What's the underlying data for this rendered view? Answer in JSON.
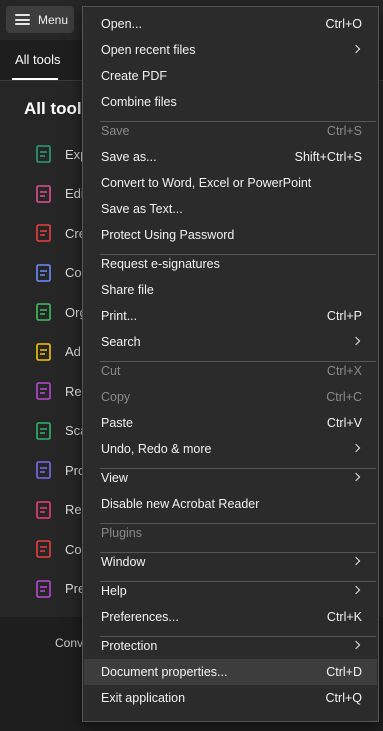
{
  "app": {
    "menu_button_label": "Menu",
    "tab_all_tools": "All tools",
    "panel_title": "All tools",
    "tools": [
      {
        "label": "Exp",
        "icon": "export-pdf-icon",
        "color": "#2d9d78"
      },
      {
        "label": "Edi",
        "icon": "edit-pdf-icon",
        "color": "#e34f8f"
      },
      {
        "label": "Cre",
        "icon": "create-pdf-icon",
        "color": "#eb3f3f"
      },
      {
        "label": "Co",
        "icon": "combine-files-icon",
        "color": "#6b8cff"
      },
      {
        "label": "Org",
        "icon": "organize-pages-icon",
        "color": "#3fbf5f"
      },
      {
        "label": "Ad",
        "icon": "add-comment-icon",
        "color": "#f5c400"
      },
      {
        "label": "Re",
        "icon": "request-signatures-icon",
        "color": "#b84ad6"
      },
      {
        "label": "Sca",
        "icon": "scan-ocr-icon",
        "color": "#2fb36b"
      },
      {
        "label": "Pro",
        "icon": "protect-icon",
        "color": "#7a6cf0"
      },
      {
        "label": "Re",
        "icon": "redact-icon",
        "color": "#eb3f7a"
      },
      {
        "label": "Co",
        "icon": "compress-pdf-icon",
        "color": "#eb3f3f"
      },
      {
        "label": "Pre",
        "icon": "prepare-form-icon",
        "color": "#b84ad6"
      }
    ],
    "below_panel_text": "Conve"
  },
  "menu": {
    "items": [
      {
        "label": "Open...",
        "shortcut": "Ctrl+O"
      },
      {
        "label": "Open recent files",
        "submenu": true
      },
      {
        "label": "Create PDF"
      },
      {
        "label": "Combine files"
      },
      {
        "label": "Save",
        "shortcut": "Ctrl+S",
        "disabled": true
      },
      {
        "label": "Save as...",
        "shortcut": "Shift+Ctrl+S"
      },
      {
        "label": "Convert to Word, Excel or PowerPoint"
      },
      {
        "label": "Save as Text..."
      },
      {
        "label": "Protect Using Password"
      },
      {
        "label": "Request e-signatures"
      },
      {
        "label": "Share file"
      },
      {
        "label": "Print...",
        "shortcut": "Ctrl+P"
      },
      {
        "label": "Search",
        "submenu": true
      },
      {
        "label": "Cut",
        "shortcut": "Ctrl+X",
        "disabled": true
      },
      {
        "label": "Copy",
        "shortcut": "Ctrl+C",
        "disabled": true
      },
      {
        "label": "Paste",
        "shortcut": "Ctrl+V"
      },
      {
        "label": "Undo, Redo & more",
        "submenu": true
      },
      {
        "label": "View",
        "submenu": true
      },
      {
        "label": "Disable new Acrobat Reader"
      },
      {
        "label": "Plugins",
        "disabled": true
      },
      {
        "label": "Window",
        "submenu": true
      },
      {
        "label": "Help",
        "submenu": true
      },
      {
        "label": "Preferences...",
        "shortcut": "Ctrl+K"
      },
      {
        "label": "Protection",
        "submenu": true
      },
      {
        "label": "Document properties...",
        "shortcut": "Ctrl+D",
        "highlighted": true
      },
      {
        "label": "Exit application",
        "shortcut": "Ctrl+Q"
      }
    ]
  }
}
